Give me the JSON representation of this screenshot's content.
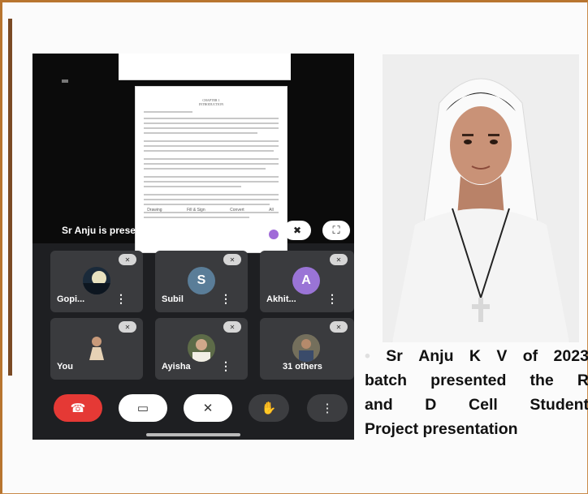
{
  "phone": {
    "presenter_label": "Sr Anju is presenting",
    "document": {
      "chapter": "CHAPTER 1",
      "title": "INTRODUCTION",
      "tools": [
        "Drawing",
        "Fill & Sign",
        "Convert",
        "All"
      ]
    },
    "participants": [
      {
        "name": "Gopi...",
        "avatar": "photo"
      },
      {
        "name": "Subil",
        "avatar": "S",
        "color": "#5a7d98"
      },
      {
        "name": "Akhit...",
        "avatar": "A",
        "color": "#9a74d6"
      },
      {
        "name": "You",
        "avatar": "photo"
      },
      {
        "name": "Ayisha",
        "avatar": "photo"
      },
      {
        "name": "31 others",
        "avatar": "photo"
      }
    ],
    "controls": [
      "end-call-icon",
      "camera-off-icon",
      "mic-off-icon",
      "raise-hand-icon",
      "more-options-icon"
    ],
    "colors": {
      "end_call": "#e53935",
      "control_bg": "#ffffff",
      "dark_control_bg": "#3c3d40"
    }
  },
  "caption": {
    "lines": [
      [
        "Sr",
        "Anju",
        "K",
        "V",
        "of",
        "2023"
      ],
      [
        "batch",
        "presented",
        "the",
        "R"
      ],
      [
        "and",
        "D",
        "Cell",
        "Student"
      ],
      [
        "Project presentation"
      ]
    ]
  }
}
